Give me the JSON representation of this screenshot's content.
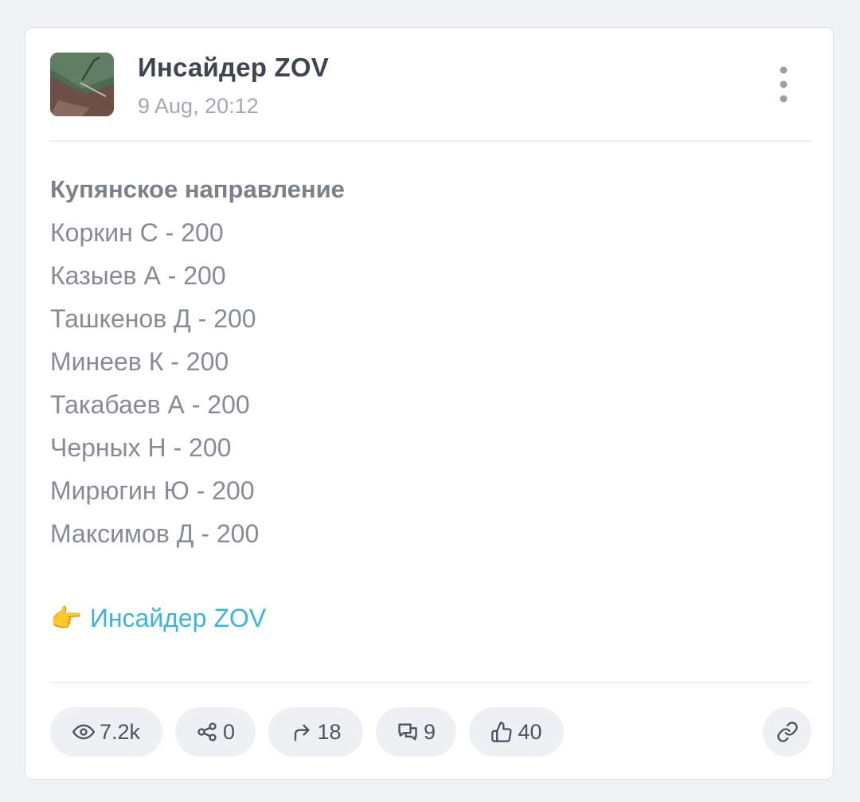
{
  "post": {
    "channel_name": "Инсайдер ZOV",
    "date": "9 Aug, 20:12",
    "menu_icon": "more-vertical-icon",
    "title": "Купянское направление",
    "lines": [
      "Коркин С - 200",
      "Казыев А - 200",
      "Ташкенов Д - 200",
      "Минеев К - 200",
      "Такабаев А - 200",
      "Черных Н - 200",
      "Мирюгин Ю - 200",
      "Максимов Д - 200"
    ],
    "signature_emoji": "👉",
    "signature_link": "Инсайдер ZOV"
  },
  "stats": {
    "views": "7.2k",
    "shares": "0",
    "forwards": "18",
    "comments": "9",
    "likes": "40"
  },
  "colors": {
    "background": "#f1f2f6",
    "card": "#ffffff",
    "link": "#3fb3dc",
    "pill": "#eef0f3"
  }
}
